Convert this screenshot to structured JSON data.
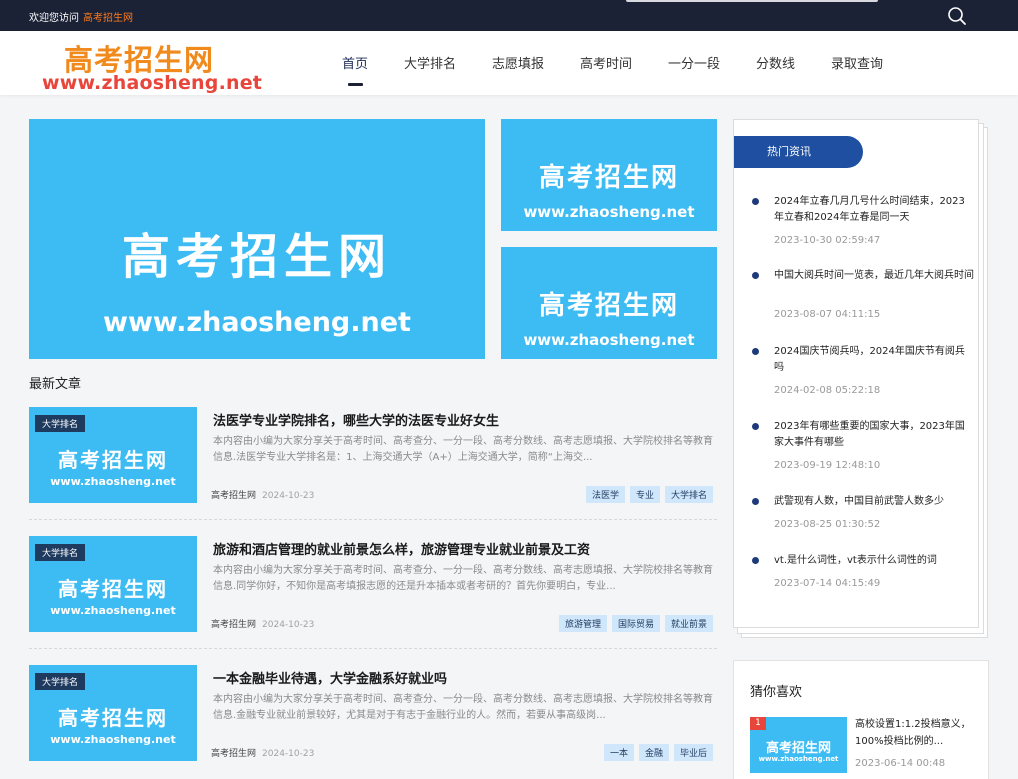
{
  "topbar": {
    "welcome": "欢迎您访问",
    "site_name": "高考招生网",
    "search_icon": "search-icon"
  },
  "brand": {
    "logo_cn": "高考招生网",
    "logo_en": "www.zhaosheng.net",
    "image_cn": "高考招生网",
    "image_en": "www.zhaosheng.net",
    "colors": {
      "topbar": "#1b2236",
      "accent_blue": "#1f4fa0",
      "image_bg": "#3dbbf3",
      "logo_orange": "#f08a1d",
      "logo_red": "#e8463a"
    }
  },
  "nav": {
    "items": [
      "首页",
      "大学排名",
      "志愿填报",
      "高考时间",
      "一分一段",
      "分数线",
      "录取查询"
    ],
    "active": "首页"
  },
  "main": {
    "latest_title": "最新文章",
    "articles": [
      {
        "category": "大学排名",
        "title": "法医学专业学院排名，哪些大学的法医专业好女生",
        "summary": "本内容由小编为大家分享关于高考时间、高考查分、一分一段、高考分数线、高考志愿填报、大学院校排名等教育信息.法医学专业大学排名是：1、上海交通大学（A+）上海交通大学，简称“上海交...",
        "author": "高考招生网",
        "date": "2024-10-23",
        "tags": [
          "法医学",
          "专业",
          "大学排名"
        ]
      },
      {
        "category": "大学排名",
        "title": "旅游和酒店管理的就业前景怎么样，旅游管理专业就业前景及工资",
        "summary": "本内容由小编为大家分享关于高考时间、高考查分、一分一段、高考分数线、高考志愿填报、大学院校排名等教育信息.同学你好，不知你是高考填报志愿的还是升本插本或者考研的？首先你要明白，专业...",
        "author": "高考招生网",
        "date": "2024-10-23",
        "tags": [
          "旅游管理",
          "国际贸易",
          "就业前景"
        ]
      },
      {
        "category": "大学排名",
        "title": "一本金融毕业待遇，大学金融系好就业吗",
        "summary": "本内容由小编为大家分享关于高考时间、高考查分、一分一段、高考分数线、高考志愿填报、大学院校排名等教育信息.金融专业就业前景较好，尤其是对于有志于金融行业的人。然而，若要从事高级岗...",
        "author": "高考招生网",
        "date": "2024-10-23",
        "tags": [
          "一本",
          "金融",
          "毕业后"
        ]
      }
    ]
  },
  "sidebar": {
    "hot_title": "热门资讯",
    "hot_news": [
      {
        "title": "2024年立春几月几号什么时间结束，2023年立春和2024年立春是同一天",
        "date": "2023-10-30 02:59:47"
      },
      {
        "title": "中国大阅兵时间一览表，最近几年大阅兵时间",
        "date": "2023-08-07 04:11:15"
      },
      {
        "title": "2024国庆节阅兵吗，2024年国庆节有阅兵吗",
        "date": "2024-02-08 05:22:18"
      },
      {
        "title": "2023年有哪些重要的国家大事，2023年国家大事件有哪些",
        "date": "2023-09-19 12:48:10"
      },
      {
        "title": "武警现有人数，中国目前武警人数多少",
        "date": "2023-08-25 01:30:52"
      },
      {
        "title": "vt.是什么词性，vt表示什么词性的词",
        "date": "2023-07-14 04:15:49"
      }
    ],
    "guess_title": "猜你喜欢",
    "guess_items": [
      {
        "rank": "1",
        "title": "高校设置1:1.2投档意义，100%投档比例的...",
        "date": "2023-06-14 00:48"
      }
    ]
  }
}
